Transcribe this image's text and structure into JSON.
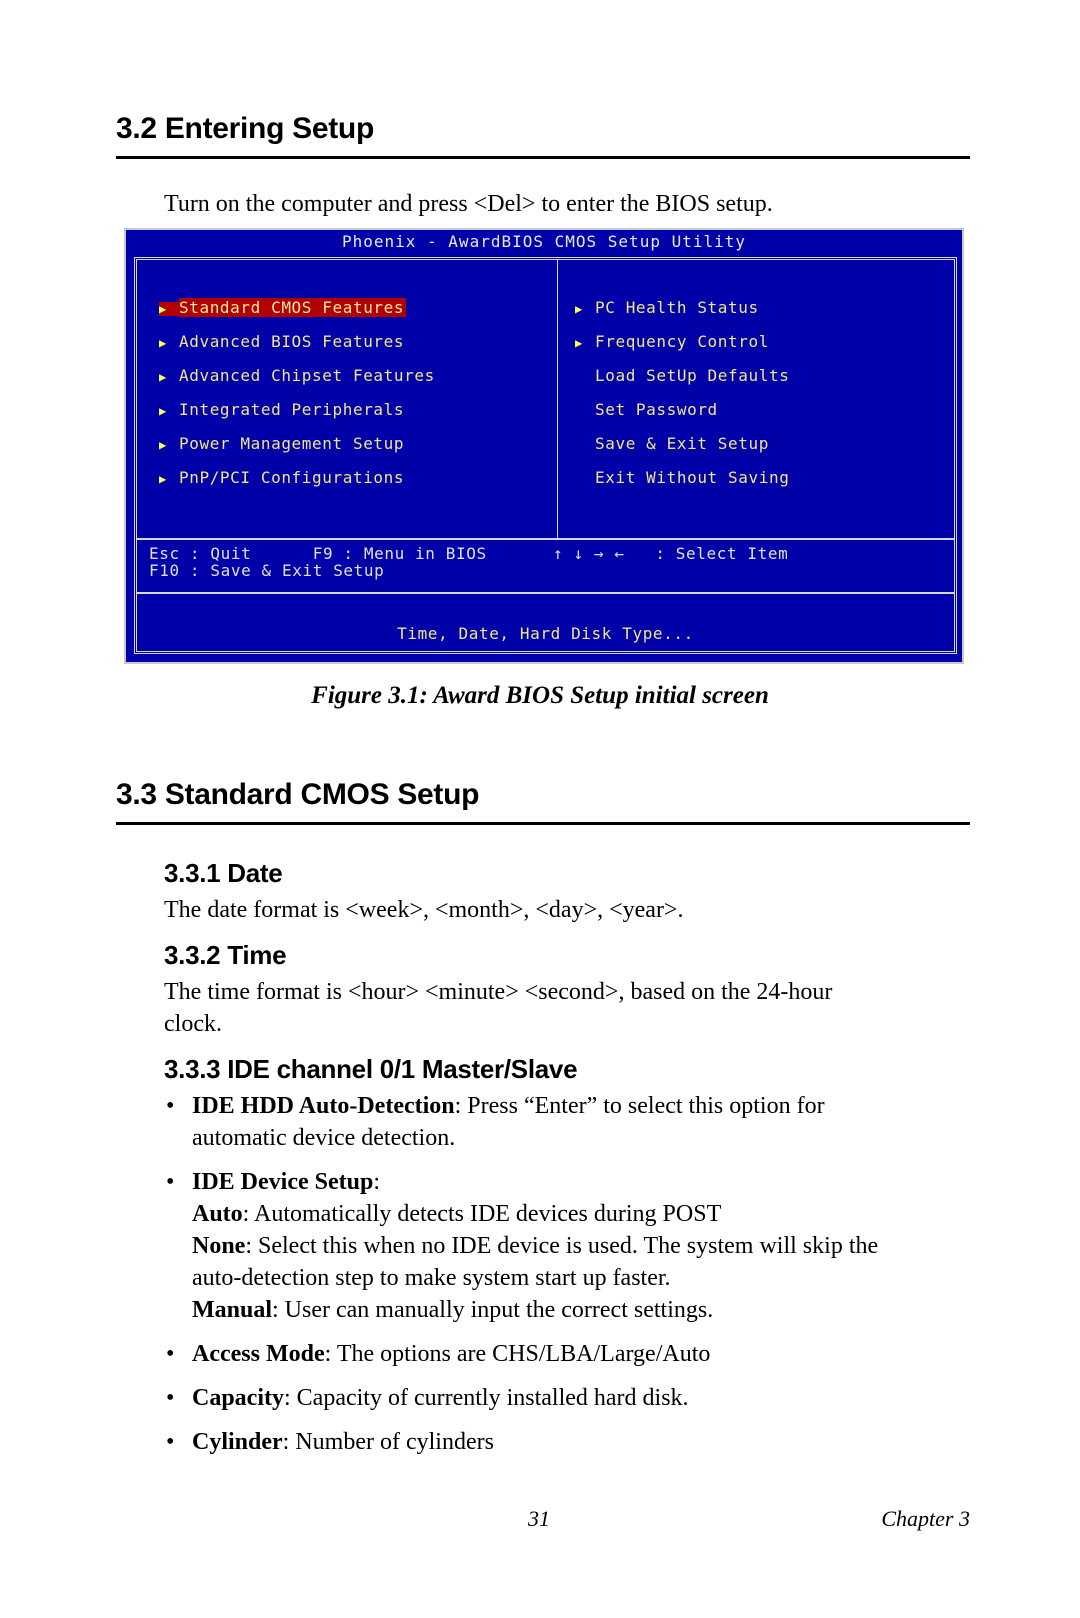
{
  "section_32": {
    "heading": "3.2  Entering Setup",
    "intro": "Turn on the computer and press <Del> to enter the BIOS setup."
  },
  "bios": {
    "title": "Phoenix - AwardBIOS CMOS Setup Utility",
    "colors": {
      "background": "#0000a8",
      "text": "#f0e68c",
      "highlight": "#b00000"
    },
    "left_menu": [
      {
        "label": "Standard CMOS Features",
        "submenu": true,
        "selected": true
      },
      {
        "label": "Advanced BIOS Features",
        "submenu": true
      },
      {
        "label": "Advanced Chipset Features",
        "submenu": true
      },
      {
        "label": "Integrated Peripherals",
        "submenu": true
      },
      {
        "label": "Power Management Setup",
        "submenu": true
      },
      {
        "label": "PnP/PCI Configurations",
        "submenu": true
      }
    ],
    "right_menu": [
      {
        "label": "PC Health Status",
        "submenu": true
      },
      {
        "label": "Frequency Control",
        "submenu": true
      },
      {
        "label": "Load SetUp Defaults",
        "submenu": false
      },
      {
        "label": "Set Password",
        "submenu": false
      },
      {
        "label": "Save & Exit Setup",
        "submenu": false
      },
      {
        "label": "Exit Without Saving",
        "submenu": false
      }
    ],
    "keys": {
      "line1_left": "Esc : Quit      F9 : Menu in BIOS",
      "line1_right": "↑ ↓ → ←   : Select Item",
      "line2": "F10 : Save & Exit Setup"
    },
    "help_text": "Time, Date, Hard Disk Type...",
    "submenu_glyph": "▶"
  },
  "figure_caption": "Figure 3.1: Award BIOS Setup initial screen",
  "section_33": {
    "heading": "3.3  Standard CMOS Setup",
    "date": {
      "heading": "3.3.1 Date",
      "text": "The date format is <week>, <month>, <day>, <year>."
    },
    "time": {
      "heading": "3.3.2 Time",
      "text_line1": "The time format is <hour> <minute> <second>, based on the 24-hour",
      "text_line2": "clock."
    },
    "ide": {
      "heading": "3.3.3 IDE channel 0/1 Master/Slave",
      "bullet_char": "•",
      "items": [
        {
          "term": "IDE HDD Auto-Detection",
          "desc_line1": ": Press “Enter” to select this option for",
          "desc_line2": "automatic device detection."
        },
        {
          "term": "IDE Device Setup",
          "desc": ":"
        },
        {
          "term": "Access Mode",
          "desc": ": The options are CHS/LBA/Large/Auto"
        },
        {
          "term": "Capacity",
          "desc": ": Capacity of currently installed hard disk."
        },
        {
          "term": "Cylinder",
          "desc": ": Number of cylinders"
        }
      ],
      "device_setup_options": [
        {
          "term": "Auto",
          "desc": ": Automatically detects IDE devices during POST"
        },
        {
          "term": "None",
          "desc_line1": ": Select this when no IDE device is used. The system will skip the",
          "desc_line2": "auto-detection step to make system start up faster."
        },
        {
          "term": "Manual",
          "desc": ": User can manually input the correct settings."
        }
      ]
    }
  },
  "footer": {
    "page_number": "31",
    "chapter": "Chapter 3"
  }
}
